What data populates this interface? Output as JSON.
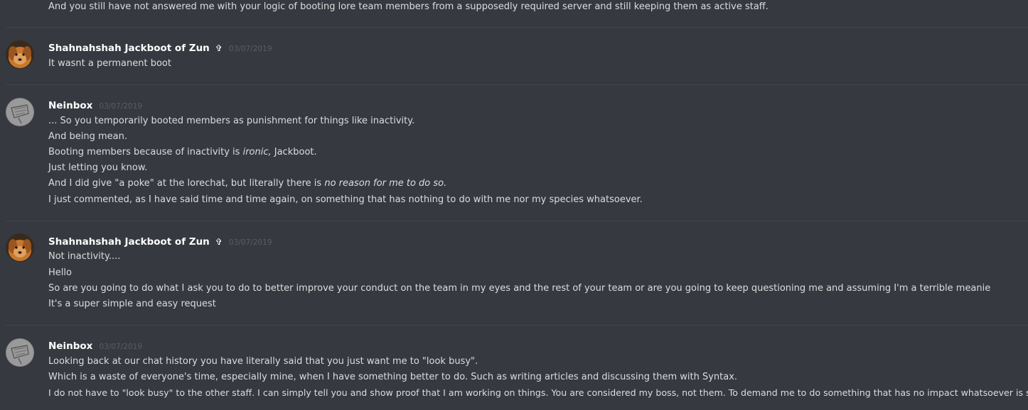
{
  "colors": {
    "background": "#36393f",
    "divider": "#42454a",
    "text": "#dcddde",
    "author": "#ffffff",
    "timestamp": "#5a5d63"
  },
  "top_continuation": "And you still have not answered me with your logic of booting lore team members from a supposedly required server and still keeping them as active staff.",
  "messages": [
    {
      "author": "Shahnahshah Jackboot of Zun",
      "badge": "✞",
      "timestamp": "03/07/2019",
      "avatar_icon": "dog-avatar-icon",
      "lines": [
        {
          "text": "It wasnt a permanent boot"
        }
      ]
    },
    {
      "author": "Neinbox",
      "timestamp": "03/07/2019",
      "avatar_icon": "sketch-avatar-icon",
      "lines": [
        {
          "text": "... So you temporarily booted members as punishment for things like inactivity."
        },
        {
          "text": "And being mean."
        },
        {
          "pre": "Booting members because of inactivity is ",
          "em": "ironic,",
          "post": " Jackboot."
        },
        {
          "text": "Just letting you know."
        },
        {
          "pre": "And I did give \"a poke\" at the lorechat, but literally there is ",
          "em": "no reason for me to do so.",
          "post": ""
        },
        {
          "text": "I just commented, as I have said time and time again, on something that has nothing to do with me nor my species whatsoever."
        }
      ]
    },
    {
      "author": "Shahnahshah Jackboot of Zun",
      "badge": "✞",
      "timestamp": "03/07/2019",
      "avatar_icon": "dog-avatar-icon",
      "lines": [
        {
          "text": "Not inactivity...."
        },
        {
          "text": "Hello"
        },
        {
          "text": "So are you going to do what I ask you to do to better improve your conduct on the team in my eyes and the rest of your team or are you going to keep questioning me and assuming I'm a terrible meanie"
        },
        {
          "text": "It's a super simple and easy request"
        }
      ]
    },
    {
      "author": "Neinbox",
      "timestamp": "03/07/2019",
      "avatar_icon": "sketch-avatar-icon",
      "lines": [
        {
          "text": "Looking back at our chat history you have literally said that you just want me to \"look busy\"."
        },
        {
          "text": "Which is a waste of everyone's time, especially mine, when I have something better to do. Such as writing articles and discussing them with Syntax."
        },
        {
          "text": "I do not have to \"look busy\" to the other staff. I can simply tell you and show proof that I am working on things. You are considered my boss, not them. To demand me to do something that has no impact whatsoever is silly."
        }
      ]
    }
  ]
}
